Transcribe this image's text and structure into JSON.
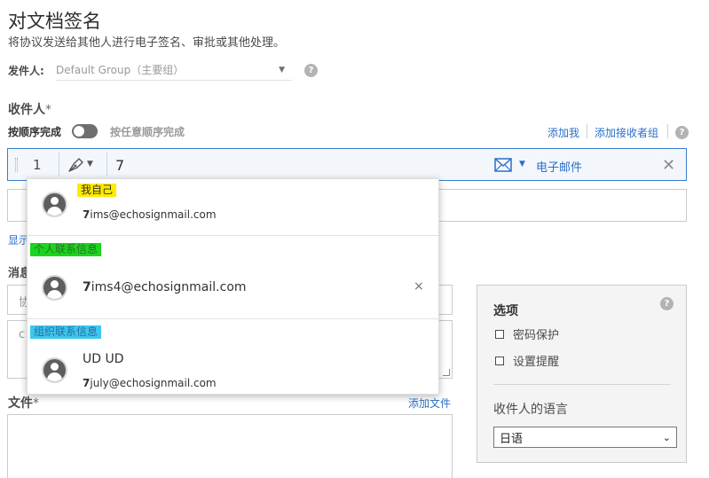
{
  "page": {
    "title": "对文档签名",
    "subtitle": "将协议发送给其他人进行电子签名、审批或其他处理。"
  },
  "sender": {
    "label": "发件人:",
    "value": "Default Group（主要组）",
    "help": "?"
  },
  "recipients": {
    "title": "收件人",
    "required_mark": "*",
    "order_sequential": "按顺序完成",
    "order_any": "按任意顺序完成",
    "add_me": "添加我",
    "add_group": "添加接收者组",
    "help": "?",
    "row": {
      "number": "1",
      "input_value": "7",
      "delivery_label": "电子邮件",
      "remove": "✕"
    },
    "show_cc": "显示"
  },
  "dropdown": {
    "groups": [
      {
        "header": "我自己",
        "header_color": "#ffea00",
        "items": [
          {
            "name": "",
            "email_match": "7",
            "email_rest": "ims@echosignmail.com"
          }
        ]
      },
      {
        "header": "个人联系信息",
        "header_color": "#19d61c",
        "items": [
          {
            "name": "",
            "email_match": "7",
            "email_rest": "ims4@echosignmail.com",
            "remove": "×"
          }
        ]
      },
      {
        "header": "组织联系信息",
        "header_color": "#3cc7f0",
        "items": [
          {
            "name": "UD UD",
            "email_match": "7",
            "email_rest": "july@echosignmail.com"
          }
        ]
      }
    ]
  },
  "message": {
    "title": "消息",
    "name_placeholder": "协",
    "body_placeholder": "c"
  },
  "files": {
    "title": "文件",
    "required_mark": "*",
    "add_file": "添加文件"
  },
  "options": {
    "title": "选项",
    "help": "?",
    "password": "密码保护",
    "reminder": "设置提醒",
    "language_label": "收件人的语言",
    "language_value": "日语"
  },
  "colors": {
    "accent": "#2c6fc9",
    "input_border_focus": "#3b7ecc"
  }
}
